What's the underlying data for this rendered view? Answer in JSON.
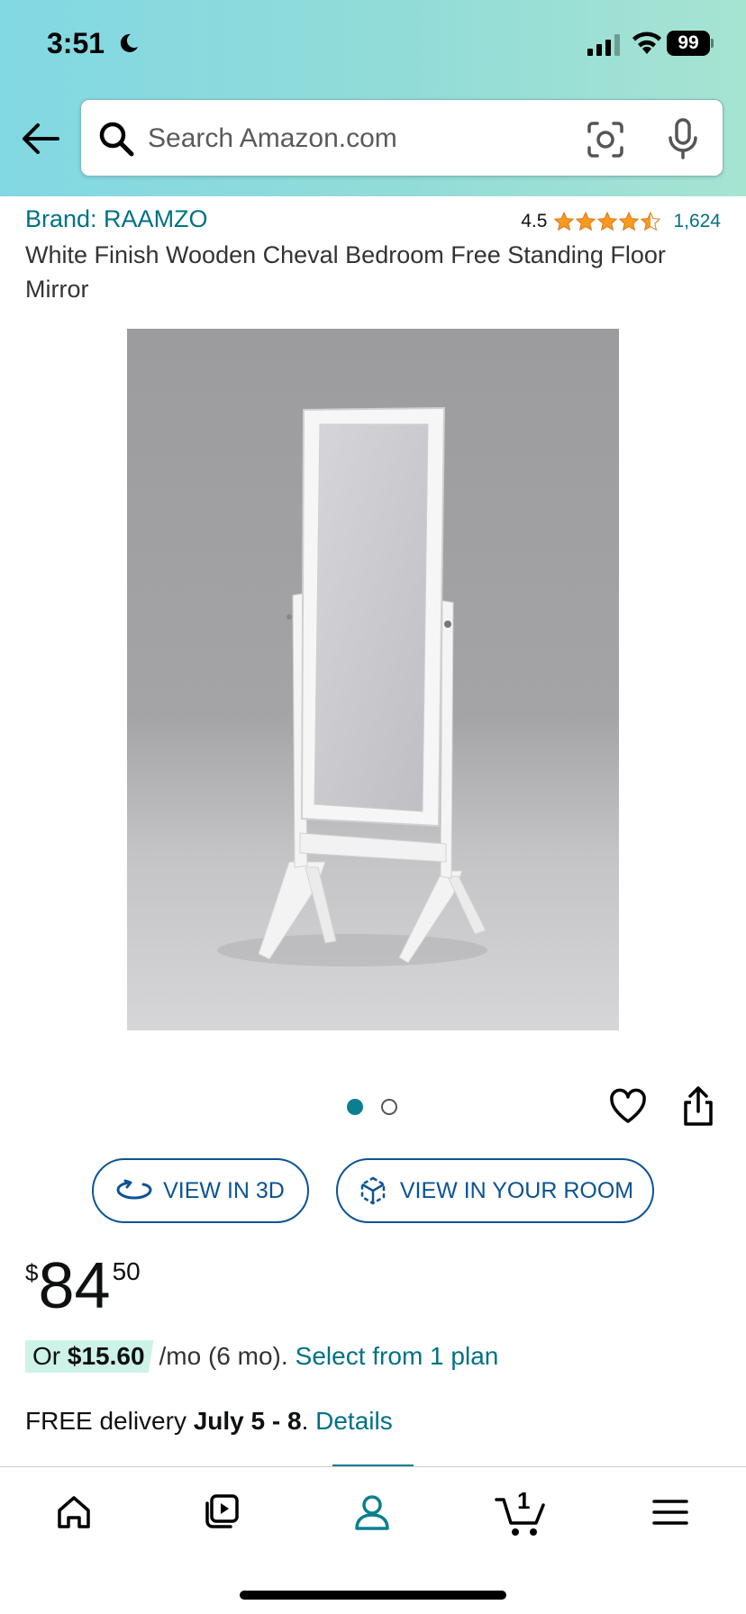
{
  "status_bar": {
    "time": "3:51",
    "battery": "99"
  },
  "search": {
    "placeholder": "Search Amazon.com"
  },
  "product": {
    "brand": "Brand: RAAMZO",
    "rating": "4.5",
    "rating_count": "1,624",
    "title": "White Finish Wooden Cheval Bedroom Free Standing Floor Mirror",
    "image_count": 2,
    "active_image": 1
  },
  "actions": {
    "view_3d": "VIEW IN 3D",
    "view_room": "VIEW IN YOUR ROOM"
  },
  "price": {
    "symbol": "$",
    "whole": "84",
    "fraction": "50"
  },
  "financing": {
    "prefix": "Or",
    "amount": "$15.60",
    "terms": "/mo (6 mo).",
    "link": "Select from 1 plan"
  },
  "delivery": {
    "prefix": "FREE delivery",
    "dates": "July 5 - 8",
    "dot": ".",
    "link": "Details"
  },
  "cart": {
    "count": "1"
  },
  "colors": {
    "accent": "#007185",
    "button": "#0b5394",
    "active_tab": "#0a7f8f",
    "star": "#f79a1e"
  }
}
